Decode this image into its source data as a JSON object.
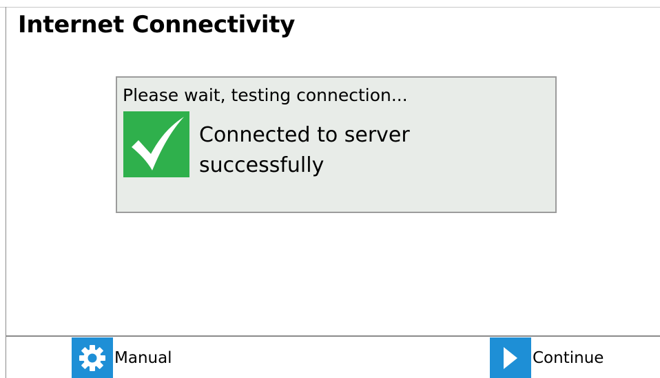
{
  "page": {
    "title": "Internet Connectivity"
  },
  "status_panel": {
    "heading": "Please wait, testing connection...",
    "icon": "checkmark-icon",
    "message": "Connected to server successfully",
    "state": "success",
    "colors": {
      "panel_background": "#e8ece8",
      "success_green": "#2fb04c"
    }
  },
  "footer": {
    "manual_button": {
      "label": "Manual",
      "icon": "gear-icon"
    },
    "continue_button": {
      "label": "Continue",
      "icon": "play-arrow-icon"
    },
    "colors": {
      "button_icon_blue": "#1e8fd6"
    }
  }
}
